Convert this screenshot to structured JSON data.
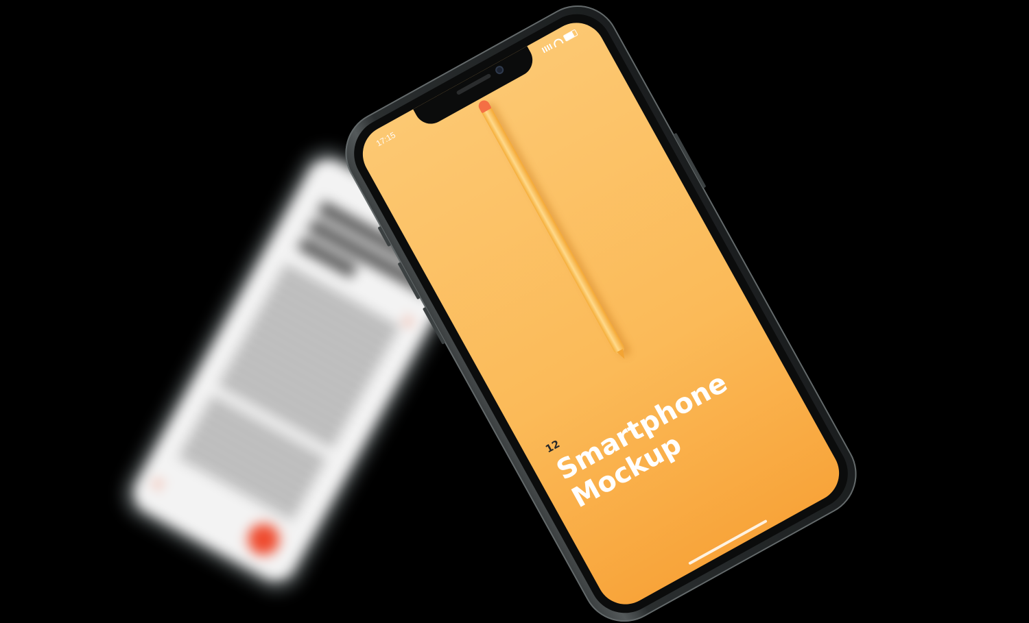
{
  "front_phone": {
    "status_time": "17:15",
    "model_number": "12",
    "title_line1": "Smartphone",
    "title_line2": "Mockup",
    "screen_colors": {
      "top": "#fcc872",
      "bottom": "#f8a43a"
    },
    "pencil_color": "#f5ad38",
    "eraser_color": "#f46f44"
  },
  "back_phone": {
    "screen_color": "#f3f3f3",
    "accent_color": "#ef4b2f"
  },
  "background_color": "#000000"
}
